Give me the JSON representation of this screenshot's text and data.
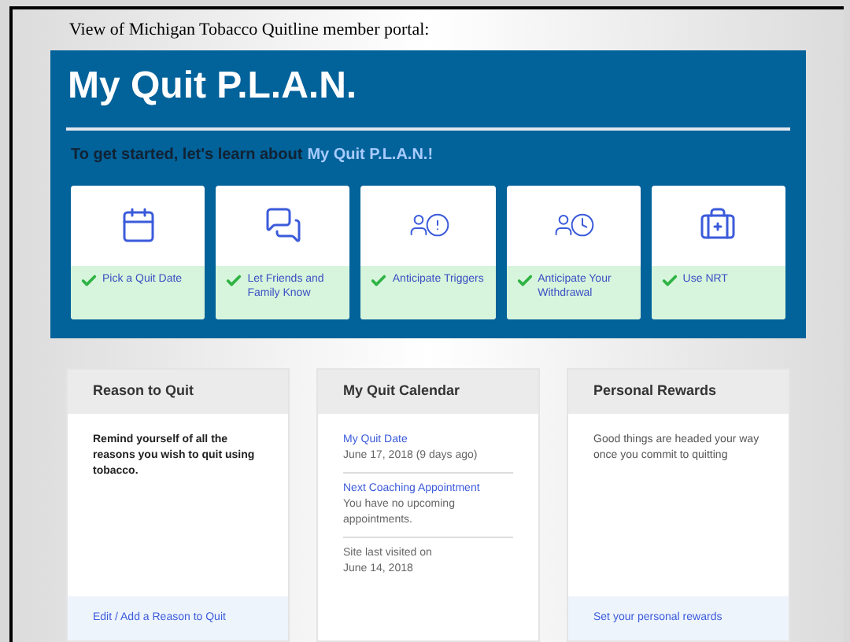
{
  "caption": "View of Michigan Tobacco Quitline member portal:",
  "banner": {
    "title": "My Quit P.L.A.N.",
    "intro": "To get started, let's learn about",
    "intro_link": "My Quit P.L.A.N.!"
  },
  "steps": [
    {
      "kind": "calendar",
      "label": "Pick a Quit Date",
      "checked": true
    },
    {
      "kind": "chat",
      "label": "Let Friends and Family Know",
      "checked": true
    },
    {
      "kind": "trigger",
      "label": "Anticipate Triggers",
      "checked": true
    },
    {
      "kind": "withdrawal",
      "label": "Anticipate Your Withdrawal",
      "checked": true
    },
    {
      "kind": "kit",
      "label": "Use NRT",
      "checked": true
    }
  ],
  "cards": [
    {
      "title": "Reason to Quit",
      "kind": "text",
      "text": "Remind yourself of all the reasons you wish to quit using tobacco.",
      "footer": "Edit / Add a Reason to Quit"
    },
    {
      "title": "My Quit Calendar",
      "kind": "calendar",
      "entries": [
        {
          "title": "My Quit Date",
          "lines": [
            "June 17, 2018 (9 days ago)"
          ]
        },
        {
          "title": "Next Coaching Appointment",
          "lines": [
            "You have no upcoming appointments."
          ]
        },
        {
          "lines": [
            "Site last visited on",
            "June 14, 2018"
          ]
        }
      ]
    },
    {
      "title": "Personal Rewards",
      "kind": "text",
      "text": "Good things are headed your way once you commit to quitting",
      "footer": "Set your personal rewards"
    }
  ]
}
